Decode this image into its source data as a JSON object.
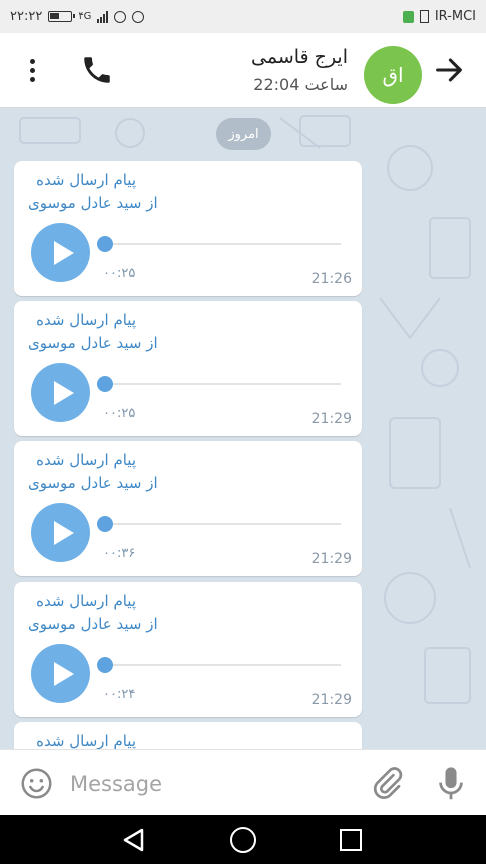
{
  "statusbar": {
    "time": "۲۲:۲۲",
    "network": "۴G",
    "carrier": "IR-MCI"
  },
  "header": {
    "contact_name": "ایرج قاسمی",
    "contact_status": "ساعت 22:04",
    "avatar_initials": "اق",
    "avatar_color": "#7bc44d"
  },
  "chat": {
    "date_label": "امروز",
    "messages": [
      {
        "forward_line1": "پیام ارسال شده",
        "forward_line2": "از سید عادل موسوی",
        "duration": "۰۰:۲۵",
        "time": "21:26"
      },
      {
        "forward_line1": "پیام ارسال شده",
        "forward_line2": "از سید عادل موسوی",
        "duration": "۰۰:۲۵",
        "time": "21:29"
      },
      {
        "forward_line1": "پیام ارسال شده",
        "forward_line2": "از سید عادل موسوی",
        "duration": "۰۰:۳۶",
        "time": "21:29"
      },
      {
        "forward_line1": "پیام ارسال شده",
        "forward_line2": "از سید عادل موسوی",
        "duration": "۰۰:۲۴",
        "time": "21:29"
      },
      {
        "forward_line1": "پیام ارسال شده",
        "forward_line2": "",
        "duration": "",
        "time": ""
      }
    ]
  },
  "composer": {
    "placeholder": "Message"
  },
  "colors": {
    "accent": "#3f88c5",
    "play_button": "#6fb0e6",
    "chat_background": "#d6e0e9"
  },
  "icons": [
    "emoji-icon",
    "attach-icon",
    "mic-icon",
    "phone-icon",
    "back-arrow-icon",
    "menu-icon",
    "play-icon"
  ]
}
